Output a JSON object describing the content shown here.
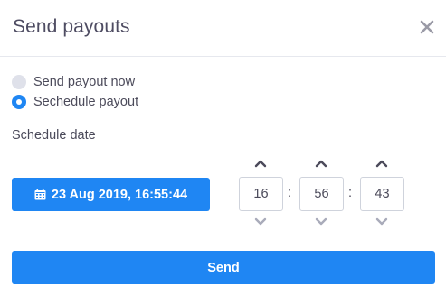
{
  "dialog": {
    "title": "Send payouts",
    "close_icon": "close-icon"
  },
  "payout_mode": {
    "options": [
      {
        "label": "Send payout now",
        "selected": false
      },
      {
        "label": "Sechedule payout",
        "selected": true
      }
    ]
  },
  "schedule": {
    "label": "Schedule date",
    "date_button_label": "23 Aug 2019, 16:55:44",
    "date_icon": "calendar-icon",
    "time": {
      "hours": "16",
      "minutes": "56",
      "seconds": "43",
      "separator": ":",
      "up_icon": "chevron-up-icon",
      "down_icon": "chevron-down-icon"
    }
  },
  "actions": {
    "send_label": "Send"
  },
  "colors": {
    "accent": "#1f86f3",
    "title_text": "#4e4c62",
    "body_text": "#4b4a5a",
    "radio_off": "#dfe1ea",
    "chevron_up": "#4b4a5a",
    "chevron_down": "#a9abba",
    "border": "#cfd3dc"
  }
}
